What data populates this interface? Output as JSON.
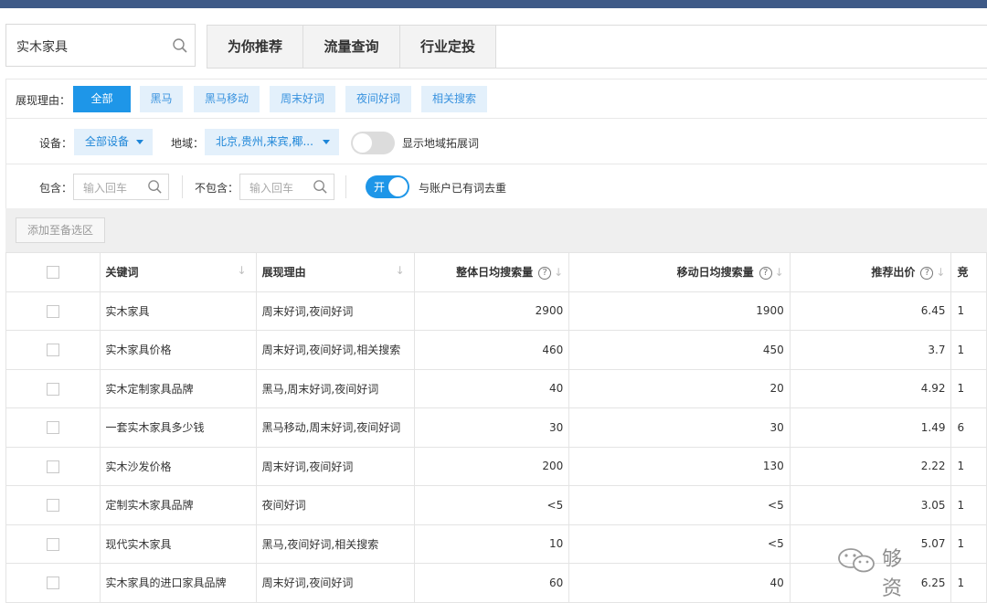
{
  "search": {
    "value": "实木家具"
  },
  "tabs": [
    {
      "label": "为你推荐"
    },
    {
      "label": "流量查询"
    },
    {
      "label": "行业定投"
    }
  ],
  "filters": {
    "reason_label": "展现理由：",
    "reasons": [
      {
        "label": "全部",
        "active": true
      },
      {
        "label": "黑马",
        "active": false
      },
      {
        "label": "黑马移动",
        "active": false
      },
      {
        "label": "周末好词",
        "active": false
      },
      {
        "label": "夜间好词",
        "active": false
      },
      {
        "label": "相关搜索",
        "active": false
      }
    ],
    "device_label": "设备：",
    "device_value": "全部设备",
    "region_label": "地域：",
    "region_value": "北京,贵州,来宾,椰...",
    "show_region_expand_label": "显示地域拓展词",
    "show_region_expand_on": false,
    "include_label": "包含：",
    "include_placeholder": "输入回车",
    "exclude_label": "不包含：",
    "exclude_placeholder": "输入回车",
    "dedupe_toggle_text": "开",
    "dedupe_label": "与账户已有词去重",
    "dedupe_on": true
  },
  "toolbar": {
    "add_label": "添加至备选区"
  },
  "table": {
    "headers": {
      "keyword": "关键词",
      "reason": "展现理由",
      "daily_search": "整体日均搜索量",
      "mobile_search": "移动日均搜索量",
      "bid": "推荐出价",
      "next": "竞"
    },
    "rows": [
      {
        "keyword": "实木家具",
        "reason": "周末好词,夜间好词",
        "daily": "2900",
        "mobile": "1900",
        "bid": "6.45",
        "next": "1"
      },
      {
        "keyword": "实木家具价格",
        "reason": "周末好词,夜间好词,相关搜索",
        "daily": "460",
        "mobile": "450",
        "bid": "3.7",
        "next": "1"
      },
      {
        "keyword": "实木定制家具品牌",
        "reason": "黑马,周末好词,夜间好词",
        "daily": "40",
        "mobile": "20",
        "bid": "4.92",
        "next": "1"
      },
      {
        "keyword": "一套实木家具多少钱",
        "reason": "黑马移动,周末好词,夜间好词",
        "daily": "30",
        "mobile": "30",
        "bid": "1.49",
        "next": "6"
      },
      {
        "keyword": "实木沙发价格",
        "reason": "周末好词,夜间好词",
        "daily": "200",
        "mobile": "130",
        "bid": "2.22",
        "next": "1"
      },
      {
        "keyword": "定制实木家具品牌",
        "reason": "夜间好词",
        "daily": "<5",
        "mobile": "<5",
        "bid": "3.05",
        "next": "1"
      },
      {
        "keyword": "现代实木家具",
        "reason": "黑马,夜间好词,相关搜索",
        "daily": "10",
        "mobile": "<5",
        "bid": "5.07",
        "next": "1"
      },
      {
        "keyword": "实木家具的进口家具品牌",
        "reason": "周末好词,夜间好词",
        "daily": "60",
        "mobile": "40",
        "bid": "6.25",
        "next": "1"
      }
    ]
  },
  "watermark": {
    "text": "够资本"
  },
  "colors": {
    "accent": "#1e96e8",
    "chip_bg": "#e3f0fb",
    "topbar": "#3e5a87"
  }
}
